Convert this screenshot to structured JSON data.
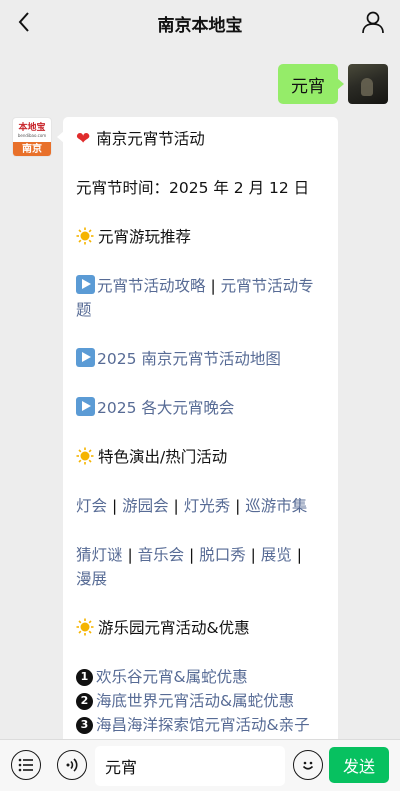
{
  "header": {
    "title": "南京本地宝",
    "back_icon": "chevron-left-icon",
    "profile_icon": "user-icon"
  },
  "user_message": {
    "text": "元宵"
  },
  "bot_avatar": {
    "logo_text": "本地宝",
    "logo_sub": "bendibao.com",
    "city_tag": "南京"
  },
  "bot_message": {
    "title": "南京元宵节活动",
    "time_line": "元宵节时间：2025 年 2 月 12 日",
    "section1": "元宵游玩推荐",
    "link_strategy_a": "元宵节活动攻略",
    "sep1": " | ",
    "link_strategy_b": "元宵节活动专题",
    "link_map": "2025 南京元宵节活动地图",
    "link_gala": "2025 各大元宵晚会",
    "section2": "特色演出/热门活动",
    "acts_row1": [
      "灯会",
      "游园会",
      "灯光秀",
      "巡游市集"
    ],
    "acts_row2": [
      "猜灯谜",
      "音乐会",
      "脱口秀",
      "展览",
      "漫展"
    ],
    "section3": "游乐园元宵活动&优惠",
    "park_items": [
      {
        "num": "1",
        "text": "欢乐谷元宵&属蛇优惠"
      },
      {
        "num": "2",
        "text": "海底世界元宵活动&属蛇优惠"
      },
      {
        "num": "3",
        "text": "海昌海洋探索馆元宵活动&亲子"
      }
    ]
  },
  "input_bar": {
    "value": "元宵",
    "send_label": "发送"
  },
  "colors": {
    "link": "#576b95",
    "send": "#07c160",
    "user_bubble": "#95ec69"
  }
}
